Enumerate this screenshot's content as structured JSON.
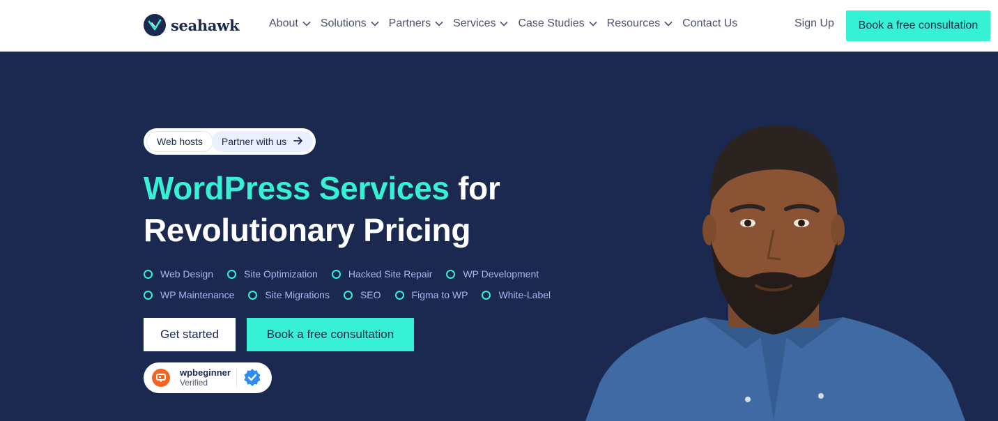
{
  "brand": {
    "name": "seahawk"
  },
  "nav": {
    "menu": [
      {
        "label": "About",
        "dropdown": true
      },
      {
        "label": "Solutions",
        "dropdown": true
      },
      {
        "label": "Partners",
        "dropdown": true
      },
      {
        "label": "Services",
        "dropdown": true
      },
      {
        "label": "Case Studies",
        "dropdown": true
      },
      {
        "label": "Resources",
        "dropdown": true
      },
      {
        "label": "Contact Us",
        "dropdown": false
      }
    ],
    "signup": "Sign Up",
    "cta": "Book a free consultation"
  },
  "hero": {
    "pill_left": "Web hosts",
    "pill_right": "Partner with us",
    "headline_accent": "WordPress Services",
    "headline_rest": " for",
    "headline_line2": "Revolutionary Pricing",
    "features_row1": [
      "Web Design",
      "Site Optimization",
      "Hacked Site Repair",
      "WP Development"
    ],
    "features_row2": [
      "WP Maintenance",
      "Site Migrations",
      "SEO",
      "Figma to WP",
      "White-Label"
    ],
    "primary_button": "Get started",
    "secondary_button": "Book a free consultation",
    "verified_name": "wpbeginner",
    "verified_sub": "Verified"
  },
  "colors": {
    "navy": "#1b2850",
    "accent": "#36f1d3",
    "feature_text": "#a7b7f0",
    "wpbeginner_orange": "#f26522",
    "verified_blue": "#2f8cf2"
  }
}
